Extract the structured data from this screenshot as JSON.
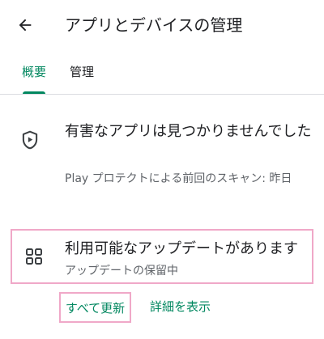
{
  "header": {
    "back_icon": "arrow-back-icon",
    "title": "アプリとデバイスの管理"
  },
  "tabs": [
    {
      "label": "概要",
      "active": true
    },
    {
      "label": "管理",
      "active": false
    }
  ],
  "protect": {
    "icon": "play-protect-shield-icon",
    "title": "有害なアプリは見つかりませんでした",
    "subtitle": "Play プロテクトによる前回のスキャン: 昨日"
  },
  "updates": {
    "icon": "apps-grid-icon",
    "title": "利用可能なアップデートがあります",
    "subtitle": "アップデートの保留中",
    "update_all_label": "すべて更新",
    "details_label": "詳細を表示"
  },
  "colors": {
    "accent": "#01875f",
    "highlight": "#f0a8c8",
    "text_primary": "#202124",
    "text_secondary": "#5f6368",
    "divider": "#dadce0"
  }
}
